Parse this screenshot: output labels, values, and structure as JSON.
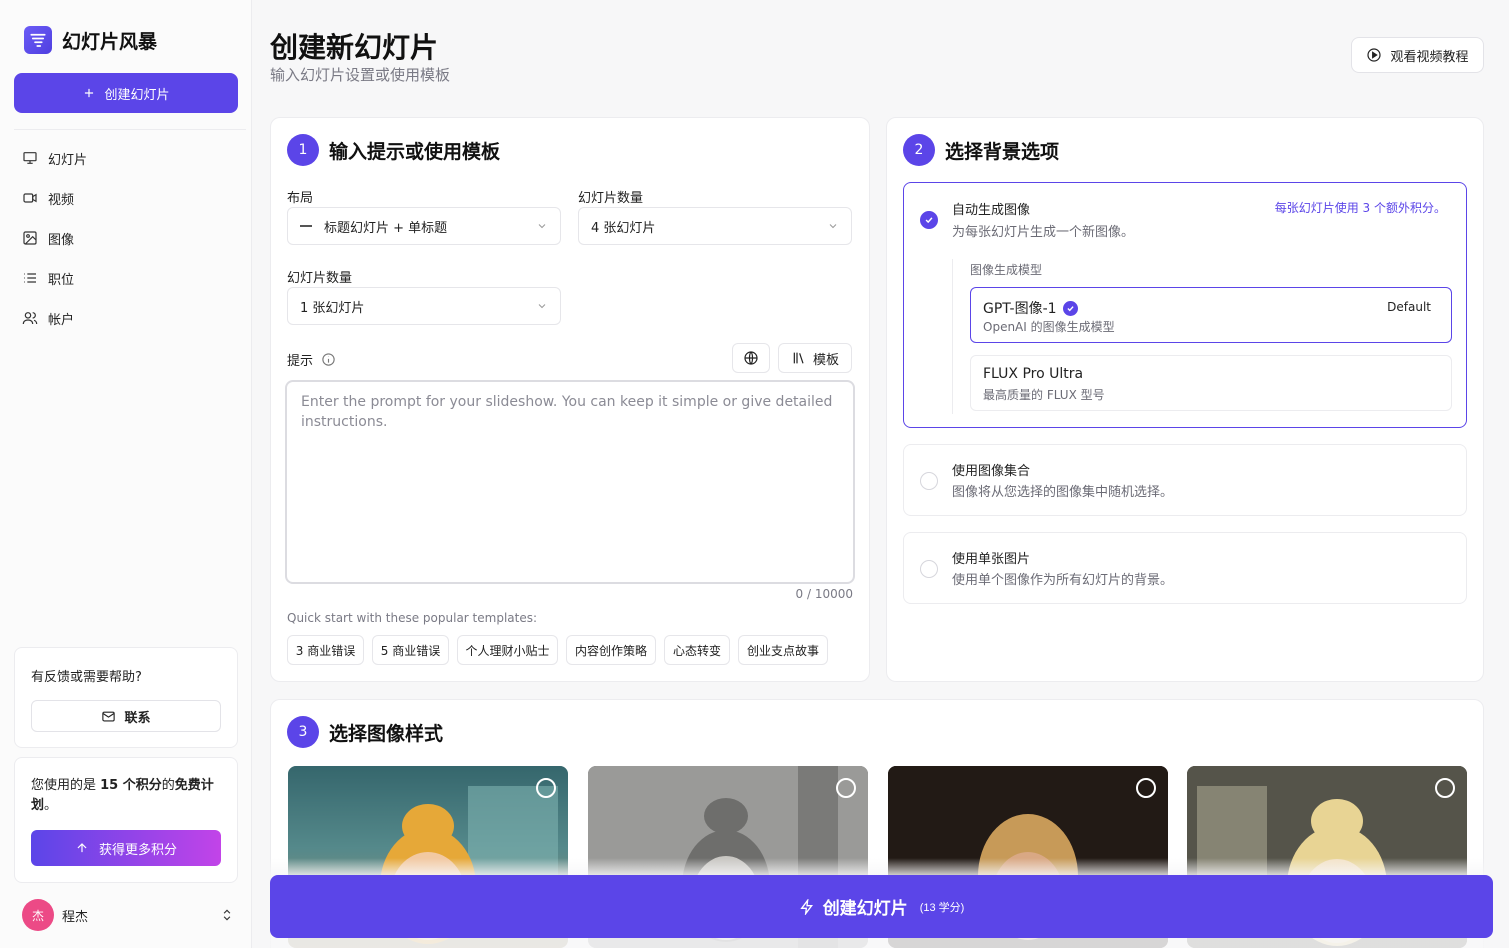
{
  "sidebar": {
    "app_name": "幻灯片风暴",
    "create_label": "创建幻灯片",
    "nav": [
      {
        "label": "幻灯片",
        "icon": "presentation-icon"
      },
      {
        "label": "视频",
        "icon": "video-icon"
      },
      {
        "label": "图像",
        "icon": "image-icon"
      },
      {
        "label": "职位",
        "icon": "list-icon"
      },
      {
        "label": "帐户",
        "icon": "users-icon"
      }
    ],
    "help_title": "有反馈或需要帮助?",
    "contact_label": "联系",
    "plan_prefix": "您使用的是 ",
    "plan_credits": "15 个积分",
    "plan_mid": "的",
    "plan_name": "免费计划",
    "plan_suffix": "。",
    "get_credits_label": "获得更多积分",
    "user_initial": "杰",
    "user_name": "程杰"
  },
  "header": {
    "title": "创建新幻灯片",
    "subtitle": "输入幻灯片设置或使用模板",
    "video_tutorial": "观看视频教程"
  },
  "step1": {
    "num": "1",
    "title": "输入提示或使用模板",
    "layout_label": "布局",
    "layout_value": "标题幻灯片 + 单标题",
    "count_label": "幻灯片数量",
    "count_value": "4 张幻灯片",
    "count2_label": "幻灯片数量",
    "count2_value": "1 张幻灯片",
    "prompt_label": "提示",
    "templates_label": "模板",
    "prompt_placeholder": "Enter the prompt for your slideshow. You can keep it simple or give detailed instructions.",
    "counter": "0 / 10000",
    "quick_start": "Quick start with these popular templates:",
    "chips": [
      "3 商业错误",
      "5 商业错误",
      "个人理财小贴士",
      "内容创作策略",
      "心态转变",
      "创业支点故事"
    ]
  },
  "step2": {
    "num": "2",
    "title": "选择背景选项",
    "auto_title": "自动生成图像",
    "auto_desc": "为每张幻灯片生成一个新图像。",
    "auto_note": "每张幻灯片使用 3 个额外积分。",
    "model_label": "图像生成模型",
    "models": [
      {
        "name": "GPT-图像-1",
        "desc": "OpenAI 的图像生成模型",
        "badge": "Default"
      },
      {
        "name": "FLUX Pro Ultra",
        "desc": "最高质量的 FLUX 型号"
      }
    ],
    "collection_title": "使用图像集合",
    "collection_desc": "图像将从您选择的图像集中随机选择。",
    "single_title": "使用单张图片",
    "single_desc": "使用单个图像作为所有幻灯片的背景。"
  },
  "step3": {
    "num": "3",
    "title": "选择图像样式",
    "styles": [
      "cartoon-style",
      "sketch-style",
      "photo-style",
      "anime-style"
    ]
  },
  "submit": {
    "label": "创建幻灯片",
    "cost": "(13 学分)"
  },
  "colors": {
    "accent": "#5b45e8",
    "avatar": "#ec4a86"
  }
}
